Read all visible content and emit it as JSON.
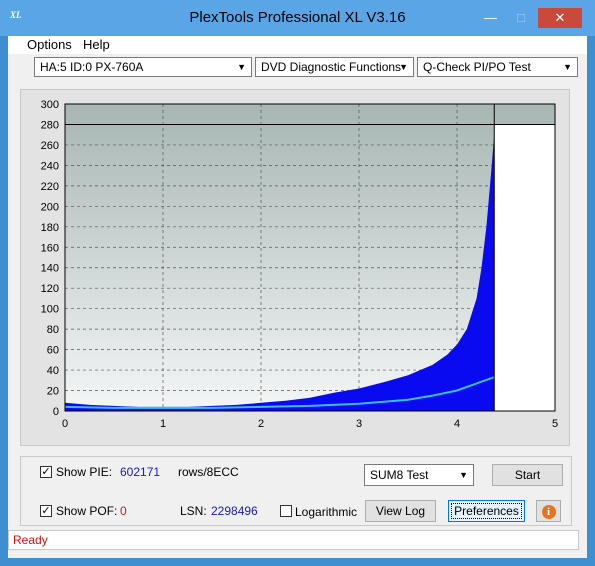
{
  "window": {
    "title": "PlexTools Professional XL V3.16",
    "logo_text": "XL"
  },
  "menu": [
    "Options",
    "Help"
  ],
  "toolbar": {
    "drive": "HA:5 ID:0  PX-760A",
    "function": "DVD Diagnostic Functions",
    "test": "Q-Check PI/PO Test"
  },
  "chart_data": {
    "type": "area",
    "xlim": [
      0,
      5
    ],
    "ylim": [
      0,
      300
    ],
    "x_ticks": [
      "0",
      "1",
      "2",
      "3",
      "4",
      "5"
    ],
    "y_ticks": [
      "0",
      "20",
      "40",
      "60",
      "80",
      "100",
      "120",
      "140",
      "160",
      "180",
      "200",
      "220",
      "240",
      "260",
      "280",
      "300"
    ],
    "threshold_line": 280,
    "end_x": 4.38,
    "grid": true,
    "colors": {
      "pie": "#0a0af0",
      "sum": "#36c0f0",
      "plot_bg_top": "#a7b6b3",
      "plot_bg_bottom": "#f4f6f6"
    },
    "series": [
      {
        "values": [
          [
            0.0,
            8
          ],
          [
            0.25,
            6
          ],
          [
            0.5,
            5
          ],
          [
            0.75,
            4
          ],
          [
            1.0,
            4
          ],
          [
            1.25,
            4
          ],
          [
            1.5,
            5
          ],
          [
            1.75,
            6
          ],
          [
            2.0,
            8
          ],
          [
            2.25,
            10
          ],
          [
            2.5,
            13
          ],
          [
            2.75,
            18
          ],
          [
            3.0,
            22
          ],
          [
            3.25,
            28
          ],
          [
            3.5,
            35
          ],
          [
            3.75,
            45
          ],
          [
            3.9,
            55
          ],
          [
            4.0,
            65
          ],
          [
            4.1,
            80
          ],
          [
            4.2,
            110
          ],
          [
            4.25,
            140
          ],
          [
            4.3,
            180
          ],
          [
            4.35,
            235
          ],
          [
            4.38,
            270
          ]
        ]
      },
      {
        "values": [
          [
            0.0,
            4
          ],
          [
            0.5,
            3
          ],
          [
            1.0,
            3
          ],
          [
            1.5,
            3
          ],
          [
            2.0,
            4
          ],
          [
            2.5,
            5
          ],
          [
            3.0,
            7
          ],
          [
            3.5,
            11
          ],
          [
            3.75,
            15
          ],
          [
            4.0,
            20
          ],
          [
            4.2,
            27
          ],
          [
            4.38,
            33
          ]
        ]
      }
    ]
  },
  "controls": {
    "show_pie_label": "Show PIE:",
    "show_pie_checked": "✓",
    "pie_value": "602171",
    "pie_unit": "rows/8ECC",
    "show_poe_label": "Show POF:",
    "show_poe_checked": "✓",
    "poe_value": "0",
    "lsn_label": "LSN:",
    "lsn_value": "2298496",
    "logarithmic_label": "Logarithmic",
    "sum_test": "SUM8 Test",
    "start": "Start",
    "view_log": "View Log",
    "preferences": "Preferences",
    "info_symbol": "i"
  },
  "status": "Ready"
}
